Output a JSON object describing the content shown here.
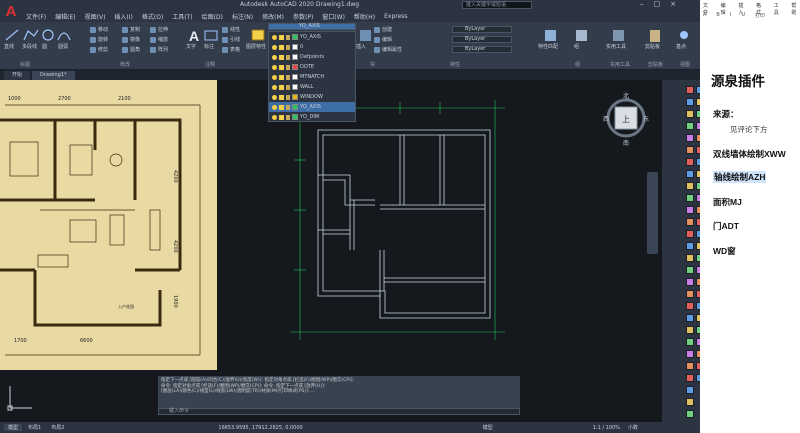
{
  "app": {
    "logo": "A",
    "title": "Autodesk AutoCAD 2020    Drawing1.dwg",
    "search_placeholder": "键入关键字或短语",
    "menu": [
      "文件(F)",
      "编辑(E)",
      "视图(V)",
      "插入(I)",
      "格式(O)",
      "工具(T)",
      "绘图(D)",
      "标注(N)",
      "修改(M)",
      "参数(P)",
      "窗口(W)",
      "帮助(H)",
      "Express"
    ]
  },
  "ribbon": {
    "big_buttons": [
      {
        "label": "直线",
        "icon": "line-icon"
      },
      {
        "label": "多段线",
        "icon": "polyline-icon"
      },
      {
        "label": "圆",
        "icon": "circle-icon"
      },
      {
        "label": "圆弧",
        "icon": "arc-icon"
      },
      {
        "label": "文字",
        "icon": "text-icon"
      },
      {
        "label": "标注",
        "icon": "dimension-icon"
      },
      {
        "label": "图层特性",
        "icon": "layer-properties-icon"
      },
      {
        "label": "插入",
        "icon": "insert-block-icon"
      },
      {
        "label": "特性匹配",
        "icon": "match-properties-icon"
      },
      {
        "label": "组",
        "icon": "group-icon"
      },
      {
        "label": "实用工具",
        "icon": "utilities-icon"
      },
      {
        "label": "剪贴板",
        "icon": "clipboard-icon"
      },
      {
        "label": "基点",
        "icon": "base-point-icon"
      }
    ],
    "modify": [
      "移动",
      "旋转",
      "修剪",
      "复制",
      "镜像",
      "圆角",
      "拉伸",
      "缩放",
      "阵列"
    ],
    "annotation": [
      "线性",
      "引线",
      "表格"
    ],
    "block": [
      "创建",
      "编辑",
      "编辑属性"
    ],
    "groups": [
      "绘图",
      "修改",
      "注释",
      "图层",
      "块",
      "特性",
      "组",
      "实用工具",
      "剪贴板",
      "视图"
    ],
    "bylayer": [
      "ByLayer",
      "ByLayer",
      "ByLayer"
    ],
    "current_layer": "YQ_AXIS"
  },
  "layer_dropdown": [
    {
      "name": "YQ_AXIS",
      "color": "#22c55e",
      "selected": true
    },
    {
      "name": "0",
      "color": "#ffffff",
      "selected": false
    },
    {
      "name": "Defpoints",
      "color": "#ffffff",
      "selected": false
    },
    {
      "name": "DOTE",
      "color": "#ef4444",
      "selected": false
    },
    {
      "name": "MTNATCH",
      "color": "#ffffff",
      "selected": false
    },
    {
      "name": "WALL",
      "color": "#ffffff",
      "selected": false
    },
    {
      "name": "WINDOW",
      "color": "#eab308",
      "selected": false
    },
    {
      "name": "YQ_AXIS",
      "color": "#22c55e",
      "selected": true
    },
    {
      "name": "YQ_DIM",
      "color": "#22c55e",
      "selected": false
    }
  ],
  "tabs": [
    {
      "label": "开始",
      "active": false
    },
    {
      "label": "Drawing1*",
      "active": true
    }
  ],
  "floorplan": {
    "dims": [
      "1000",
      "2700",
      "2100",
      "4200",
      "4200",
      "1900",
      "1700",
      "6600"
    ],
    "rooms": [
      "入户花园"
    ]
  },
  "viewcube": {
    "north": "北",
    "south": "南",
    "west": "西",
    "east": "东",
    "face": "上"
  },
  "command": {
    "lines": [
      "指定下一点或 [圆弧(A)/闭合(C)/放弃(U)/宽度(W)]: 指定对角点或 [栏选(F)/圈围(WP)/圈交(CP)]:",
      "命令: 指定对角点或 [栏选(F)/圈围(WP)/圈交(CP)]: 命令: 指定下一点或 [放弃(U)]:",
      "[图层(LA)/颜色(C)/线型(L)/线宽(LW)/透明度(TR)/材质(M)/打印样式(PS)]: ..."
    ],
    "input_placeholder": "键入命令"
  },
  "status": {
    "tabs": [
      "模型",
      "布局1",
      "布局2"
    ],
    "coords": "16653.9595, 17912.2825, 0.0000",
    "model": "模型",
    "scale": "1:1 / 100%",
    "units": "小数"
  },
  "panel": {
    "menu": [
      "文件",
      "编辑",
      "插入",
      "格式",
      "工具",
      "帮助"
    ],
    "toolbar": [
      "A",
      "B",
      "I",
      "U",
      "打印"
    ],
    "title": "源泉插件",
    "source_label": "来源：",
    "source_value": "见评论下方",
    "items": [
      {
        "label": "双线墙体绘制XWW",
        "highlight": false
      },
      {
        "label": "轴线绘制AZH",
        "highlight": true
      },
      {
        "label": "面积MJ",
        "highlight": false
      },
      {
        "label": "门ADT",
        "highlight": false
      },
      {
        "label": "WD窗",
        "highlight": false
      }
    ]
  },
  "colors": {
    "accent": "#3d6ea5",
    "wall": "#b8c8d8",
    "axis": "#22c55e",
    "dim": "#22c55e"
  }
}
